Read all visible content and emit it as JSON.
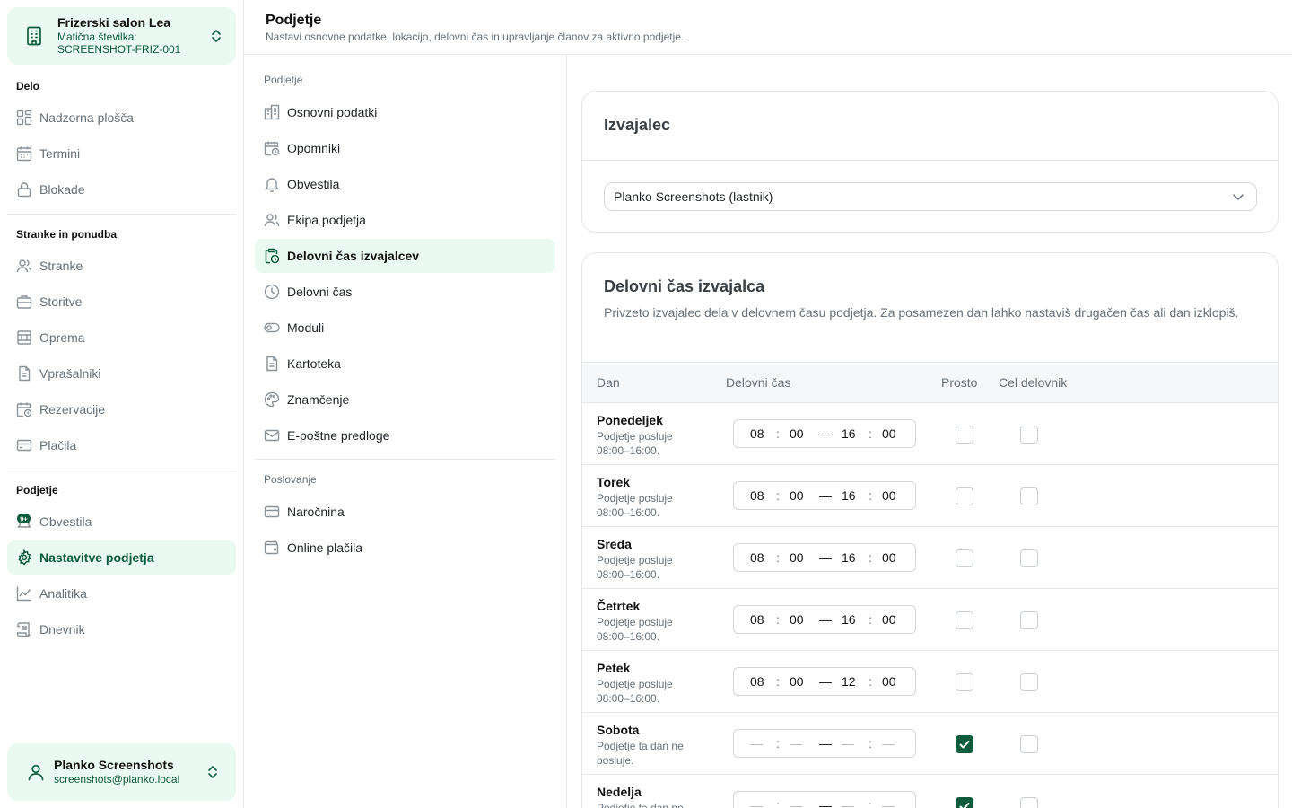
{
  "org": {
    "name": "Frizerski salon Lea",
    "reg_label": "Matična številka:",
    "reg_code": "SCREENSHOT-FRIZ-001"
  },
  "sidebar": {
    "sections": [
      {
        "heading": "Delo",
        "items": [
          {
            "label": "Nadzorna plošča",
            "icon": "dashboard-icon"
          },
          {
            "label": "Termini",
            "icon": "calendar-icon"
          },
          {
            "label": "Blokade",
            "icon": "lock-icon"
          }
        ]
      },
      {
        "heading": "Stranke in ponudba",
        "items": [
          {
            "label": "Stranke",
            "icon": "users-icon"
          },
          {
            "label": "Storitve",
            "icon": "briefcase-icon"
          },
          {
            "label": "Oprema",
            "icon": "equipment-icon"
          },
          {
            "label": "Vprašalniki",
            "icon": "document-icon"
          },
          {
            "label": "Rezervacije",
            "icon": "calendar-clock-icon"
          },
          {
            "label": "Plačila",
            "icon": "card-icon"
          }
        ]
      },
      {
        "heading": "Podjetje",
        "items": [
          {
            "label": "Obvestila",
            "icon": "notification-badge-icon",
            "badge": "9+"
          },
          {
            "label": "Nastavitve podjetja",
            "icon": "gear-icon",
            "active": true
          },
          {
            "label": "Analitika",
            "icon": "chart-line-icon"
          },
          {
            "label": "Dnevnik",
            "icon": "scroll-icon"
          }
        ]
      }
    ]
  },
  "user": {
    "name": "Planko Screenshots",
    "email": "screenshots@planko.local"
  },
  "header": {
    "title": "Podjetje",
    "subtitle": "Nastavi osnovne podatke, lokacijo, delovni čas in upravljanje članov za aktivno podjetje."
  },
  "subnav": {
    "company_heading": "Podjetje",
    "company_items": [
      {
        "label": "Osnovni podatki",
        "icon": "building-icon"
      },
      {
        "label": "Opomniki",
        "icon": "calendar-clock-icon"
      },
      {
        "label": "Obvestila",
        "icon": "bell-icon"
      },
      {
        "label": "Ekipa podjetja",
        "icon": "users-icon"
      },
      {
        "label": "Delovni čas izvajalcev",
        "icon": "clipboard-clock-icon",
        "active": true
      },
      {
        "label": "Delovni čas",
        "icon": "clock-icon"
      },
      {
        "label": "Moduli",
        "icon": "toggle-icon"
      },
      {
        "label": "Kartoteka",
        "icon": "file-icon"
      },
      {
        "label": "Znamčenje",
        "icon": "palette-icon"
      },
      {
        "label": "E-poštne predloge",
        "icon": "mail-icon"
      }
    ],
    "business_heading": "Poslovanje",
    "business_items": [
      {
        "label": "Naročnina",
        "icon": "card-icon"
      },
      {
        "label": "Online plačila",
        "icon": "wallet-icon"
      }
    ]
  },
  "performer": {
    "title": "Izvajalec",
    "selected": "Planko Screenshots (lastnik)"
  },
  "hours": {
    "title": "Delovni čas izvajalca",
    "description": "Privzeto izvajalec dela v delovnem času podjetja. Za posamezen dan lahko nastaviš drugačen čas ali dan izklopiš.",
    "columns": {
      "day": "Dan",
      "time": "Delovni čas",
      "free": "Prosto",
      "full": "Cel delovnik"
    },
    "days": [
      {
        "name": "Ponedeljek",
        "note": "Podjetje posluje 08:00–16:00.",
        "from_h": "08",
        "from_m": "00",
        "to_h": "16",
        "to_m": "00",
        "free": false,
        "full": false
      },
      {
        "name": "Torek",
        "note": "Podjetje posluje 08:00–16:00.",
        "from_h": "08",
        "from_m": "00",
        "to_h": "16",
        "to_m": "00",
        "free": false,
        "full": false
      },
      {
        "name": "Sreda",
        "note": "Podjetje posluje 08:00–16:00.",
        "from_h": "08",
        "from_m": "00",
        "to_h": "16",
        "to_m": "00",
        "free": false,
        "full": false
      },
      {
        "name": "Četrtek",
        "note": "Podjetje posluje 08:00–16:00.",
        "from_h": "08",
        "from_m": "00",
        "to_h": "16",
        "to_m": "00",
        "free": false,
        "full": false
      },
      {
        "name": "Petek",
        "note": "Podjetje posluje 08:00–16:00.",
        "from_h": "08",
        "from_m": "00",
        "to_h": "12",
        "to_m": "00",
        "free": false,
        "full": false
      },
      {
        "name": "Sobota",
        "note": "Podjetje ta dan ne posluje.",
        "from_h": "—",
        "from_m": "—",
        "to_h": "—",
        "to_m": "—",
        "free": true,
        "full": false
      },
      {
        "name": "Nedelja",
        "note": "Podjetje ta dan ne posluje.",
        "from_h": "—",
        "from_m": "—",
        "to_h": "—",
        "to_m": "—",
        "free": true,
        "full": false
      }
    ],
    "dash": "—",
    "colon": ":"
  },
  "colors": {
    "accent": "#0d5c3c",
    "accent_bg": "#eafaf2",
    "muted": "#667078"
  }
}
